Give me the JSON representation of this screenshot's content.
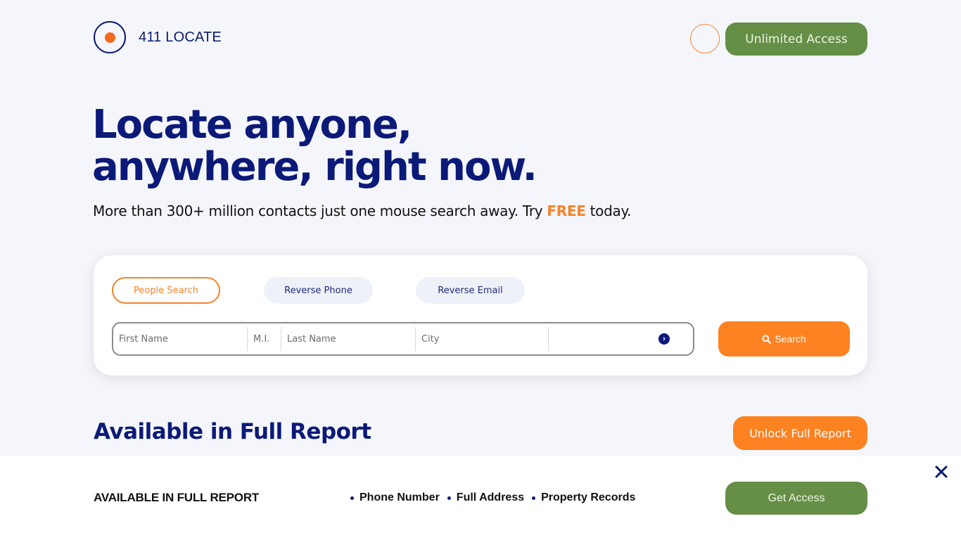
{
  "header": {
    "logo_text": "411 LOCATE",
    "unlimited_access_label": "Unlimited Access"
  },
  "hero": {
    "title_line1": "Locate anyone,",
    "title_line2": "anywhere, right now.",
    "subtitle_before": "More than 300+ million contacts just one mouse search away. Try ",
    "subtitle_highlight": "FREE",
    "subtitle_after": " today."
  },
  "search": {
    "tabs": [
      {
        "label": "People Search",
        "active": true
      },
      {
        "label": "Reverse Phone",
        "active": false
      },
      {
        "label": "Reverse Email",
        "active": false
      }
    ],
    "fields": {
      "first_name": {
        "placeholder": "First Name",
        "value": ""
      },
      "middle_initial": {
        "placeholder": "M.I.",
        "value": ""
      },
      "last_name": {
        "placeholder": "Last Name",
        "value": ""
      },
      "city": {
        "placeholder": "City",
        "value": ""
      },
      "state": {
        "value": ""
      }
    },
    "button_label": "Search",
    "icons": {
      "search": "search-icon",
      "dropdown": "chevron-right-circle-icon"
    }
  },
  "report_section": {
    "title": "Available in Full Report",
    "unlock_label": "Unlock Full Report"
  },
  "bottom_bar": {
    "title": "AVAILABLE IN FULL REPORT",
    "items": [
      "Phone Number",
      "Full Address",
      "Property Records"
    ],
    "cta_label": "Get Access",
    "close_icon": "close-icon"
  },
  "colors": {
    "brand_navy": "#0b1a78",
    "accent_orange": "#fd8222",
    "accent_green": "#658e46",
    "background": "#f4f6fb"
  }
}
